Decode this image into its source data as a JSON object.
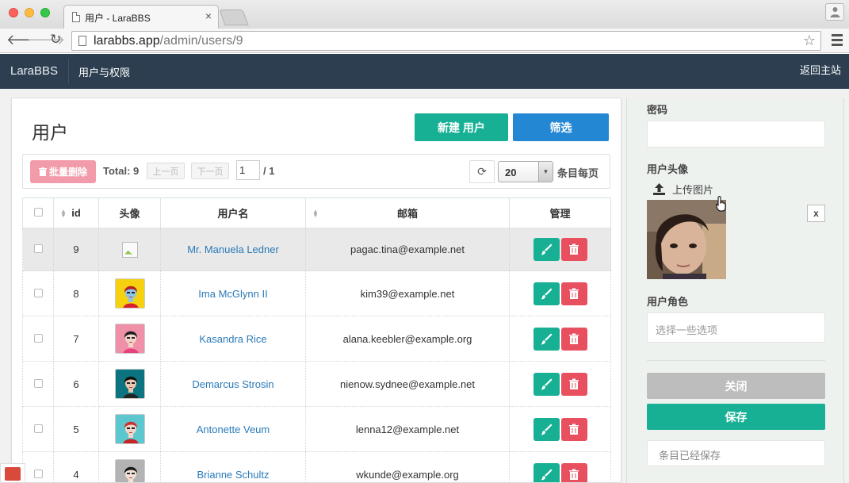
{
  "browser": {
    "tab_title": "用户 - LaraBBS",
    "url_host": "larabbs.app",
    "url_path": "/admin/users/9"
  },
  "navbar": {
    "brand": "LaraBBS",
    "link": "用户与权限",
    "right_link": "返回主站",
    "bg_color": "#2c3e50"
  },
  "page": {
    "title": "用户",
    "new_button": "新建 用户",
    "filter_button": "筛选"
  },
  "toolbar": {
    "batch_delete": "批量删除",
    "total": "Total: 9",
    "prev": "上一页",
    "next": "下一页",
    "page_value": "1",
    "page_of": "/ 1",
    "per_page": "20",
    "per_page_label": "条目每页"
  },
  "table": {
    "headers": {
      "id": "id",
      "avatar": "头像",
      "name": "用户名",
      "email": "邮箱",
      "actions": "管理"
    },
    "rows": [
      {
        "id": "9",
        "name": "Mr. Manuela Ledner",
        "email": "pagac.tina@example.net",
        "avatar": "broken-image"
      },
      {
        "id": "8",
        "name": "Ima McGlynn II",
        "email": "kim39@example.net",
        "avatar": "yellow"
      },
      {
        "id": "7",
        "name": "Kasandra Rice",
        "email": "alana.keebler@example.org",
        "avatar": "pink"
      },
      {
        "id": "6",
        "name": "Demarcus Strosin",
        "email": "nienow.sydnee@example.net",
        "avatar": "teal"
      },
      {
        "id": "5",
        "name": "Antonette Veum",
        "email": "lenna12@example.net",
        "avatar": "cyan"
      },
      {
        "id": "4",
        "name": "Brianne Schultz",
        "email": "wkunde@example.org",
        "avatar": "grey"
      }
    ]
  },
  "side_form": {
    "password_label": "密码",
    "password_value": "",
    "avatar_label": "用户头像",
    "upload_label": "上传图片",
    "remove_label": "x",
    "roles_label": "用户角色",
    "roles_placeholder": "选择一些选项",
    "close_button": "关闭",
    "save_button": "保存",
    "saved_message": "条目已经保存"
  },
  "colors": {
    "accent": "#17b094",
    "primary": "#2487d3",
    "danger": "#e9505f",
    "link": "#2a7ab8"
  }
}
